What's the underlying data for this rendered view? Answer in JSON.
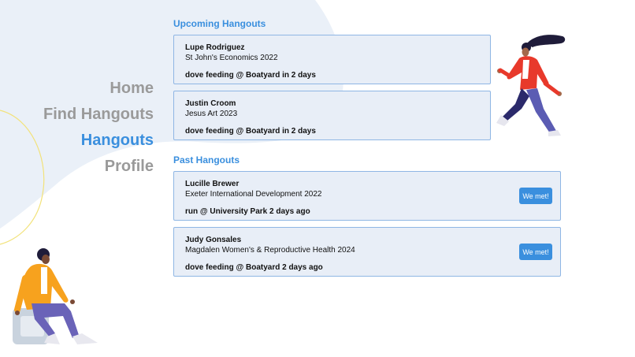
{
  "nav": {
    "items": [
      {
        "label": "Home",
        "active": false
      },
      {
        "label": "Find Hangouts",
        "active": false
      },
      {
        "label": "Hangouts",
        "active": true
      },
      {
        "label": "Profile",
        "active": false
      }
    ]
  },
  "upcoming": {
    "title": "Upcoming Hangouts",
    "items": [
      {
        "name": "Lupe Rodriguez",
        "course": "St John's Economics 2022",
        "event": "dove feeding @ Boatyard in 2 days"
      },
      {
        "name": "Justin Croom",
        "course": "Jesus Art 2023",
        "event": "dove feeding @ Boatyard in 2 days"
      }
    ]
  },
  "past": {
    "title": "Past Hangouts",
    "items": [
      {
        "name": "Lucille Brewer",
        "course": "Exeter International Development 2022",
        "event": "run @ University Park 2 days ago",
        "button": "We met!"
      },
      {
        "name": "Judy Gonsales",
        "course": "Magdalen Women's & Reproductive Health 2024",
        "event": "dove feeding @ Boatyard 2 days ago",
        "button": "We met!"
      }
    ]
  },
  "colors": {
    "accent": "#3a8fde",
    "card_bg": "#e8eef7",
    "card_border": "#8fb6e4",
    "nav_inactive": "#9a9a9a",
    "wave": "#eaf0f8"
  },
  "illustrations": [
    "running-person-illustration",
    "sitting-person-illustration"
  ]
}
